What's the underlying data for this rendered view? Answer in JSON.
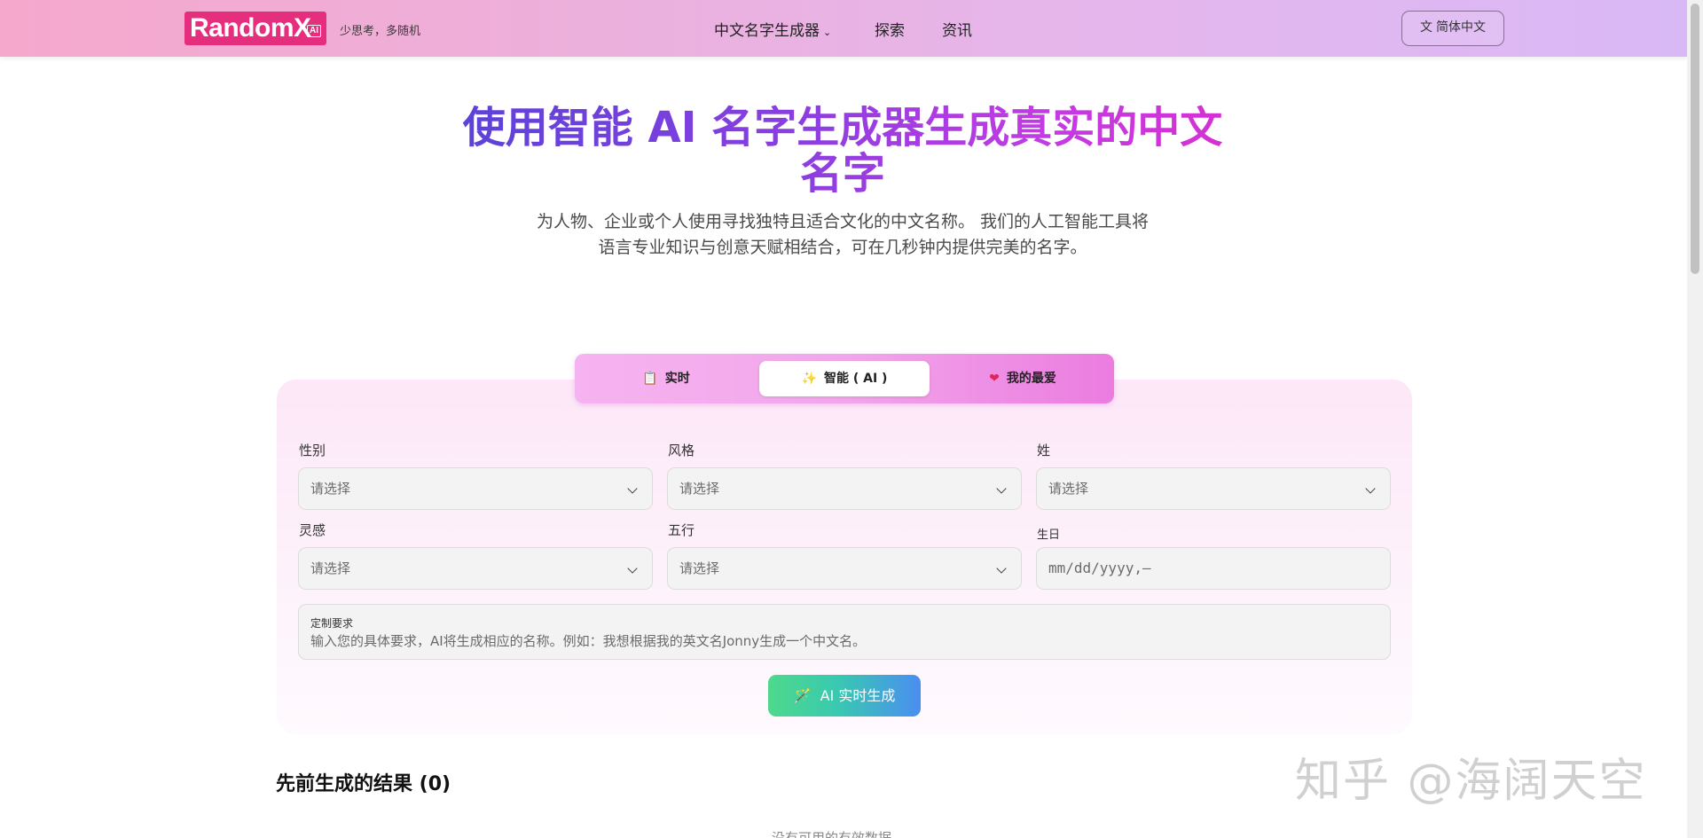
{
  "header": {
    "logo_text": "RandomX",
    "logo_badge": "AI",
    "slogan": "少思考，多随机",
    "nav": {
      "generator": "中文名字生成器",
      "explore": "探索",
      "news": "资讯"
    },
    "language_button": "简体中文"
  },
  "hero": {
    "title": "使用智能 AI 名字生成器生成真实的中文名字",
    "subtitle": "为人物、企业或个人使用寻找独特且适合文化的中文名称。 我们的人工智能工具将语言专业知识与创意天赋相结合，可在几秒钟内提供完美的名字。"
  },
  "tabs": [
    {
      "label": "实时",
      "icon": "clipboard-icon",
      "active": false
    },
    {
      "label": "智能 ( AI )",
      "icon": "sparkles-icon",
      "active": true
    },
    {
      "label": "我的最爱",
      "icon": "heart-icon",
      "active": false
    }
  ],
  "form": {
    "gender": {
      "label": "性别",
      "value": "请选择"
    },
    "style": {
      "label": "风格",
      "value": "请选择"
    },
    "surname": {
      "label": "姓",
      "value": "请选择"
    },
    "inspiration": {
      "label": "灵感",
      "value": "请选择"
    },
    "five_elements": {
      "label": "五行",
      "value": "请选择"
    },
    "birthday": {
      "label": "生日",
      "placeholder": "mm/dd/yyyy,—"
    },
    "custom": {
      "label": "定制要求",
      "placeholder": "输入您的具体要求，AI将生成相应的名称。例如：我想根据我的英文名Jonny生成一个中文名。"
    },
    "generate_button": "AI 实时生成"
  },
  "results": {
    "title": "先前生成的结果 (0)",
    "empty_text": "没有可用的有效数据"
  },
  "watermark": "知乎 @海阔天空",
  "colors": {
    "logo_bg": "#e52e7e",
    "title_gradient_start": "#5a43d8",
    "title_gradient_end": "#d72fd2",
    "button_gradient_start": "#4ed98c",
    "button_gradient_end": "#4a8ef1"
  }
}
